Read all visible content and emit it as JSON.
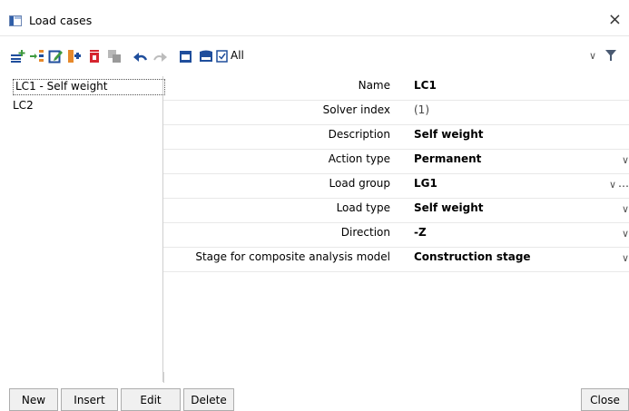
{
  "window": {
    "title": "Load cases",
    "close_glyph": "×"
  },
  "toolbar": {
    "icons": [
      "new-icon",
      "insert-icon",
      "edit-icon",
      "copy-icon",
      "delete-icon",
      "duplicate-icon",
      "undo-icon",
      "redo-icon",
      "window-icon",
      "save-icon",
      "check-icon"
    ],
    "filter_label": "All",
    "filter_dropdown_glyph": "∨",
    "filter_icon": "funnel-icon"
  },
  "list": {
    "items": [
      "LC1 - Self weight",
      "LC2"
    ],
    "selected_index": 0
  },
  "properties": [
    {
      "label": "Name",
      "value": "LC1"
    },
    {
      "label": "Solver index",
      "value": "(1)"
    },
    {
      "label": "Description",
      "value": "Self weight"
    },
    {
      "label": "Action type",
      "value": "Permanent",
      "dropdown": "∨"
    },
    {
      "label": "Load group",
      "value": "LG1",
      "dropdown": "∨",
      "extra": "…"
    },
    {
      "label": "Load type",
      "value": "Self weight",
      "dropdown": "∨"
    },
    {
      "label": "Direction",
      "value": "-Z",
      "dropdown": "∨"
    },
    {
      "label": "Stage for composite analysis model",
      "value": "Construction stage",
      "dropdown": "∨"
    }
  ],
  "buttons": {
    "new": "New",
    "insert": "Insert",
    "edit": "Edit",
    "delete": "Delete",
    "close": "Close"
  },
  "colors": {
    "accent_blue": "#1f4e9c",
    "accent_red": "#d6262f",
    "accent_orange": "#e7892b",
    "accent_green": "#3f9a3f"
  }
}
